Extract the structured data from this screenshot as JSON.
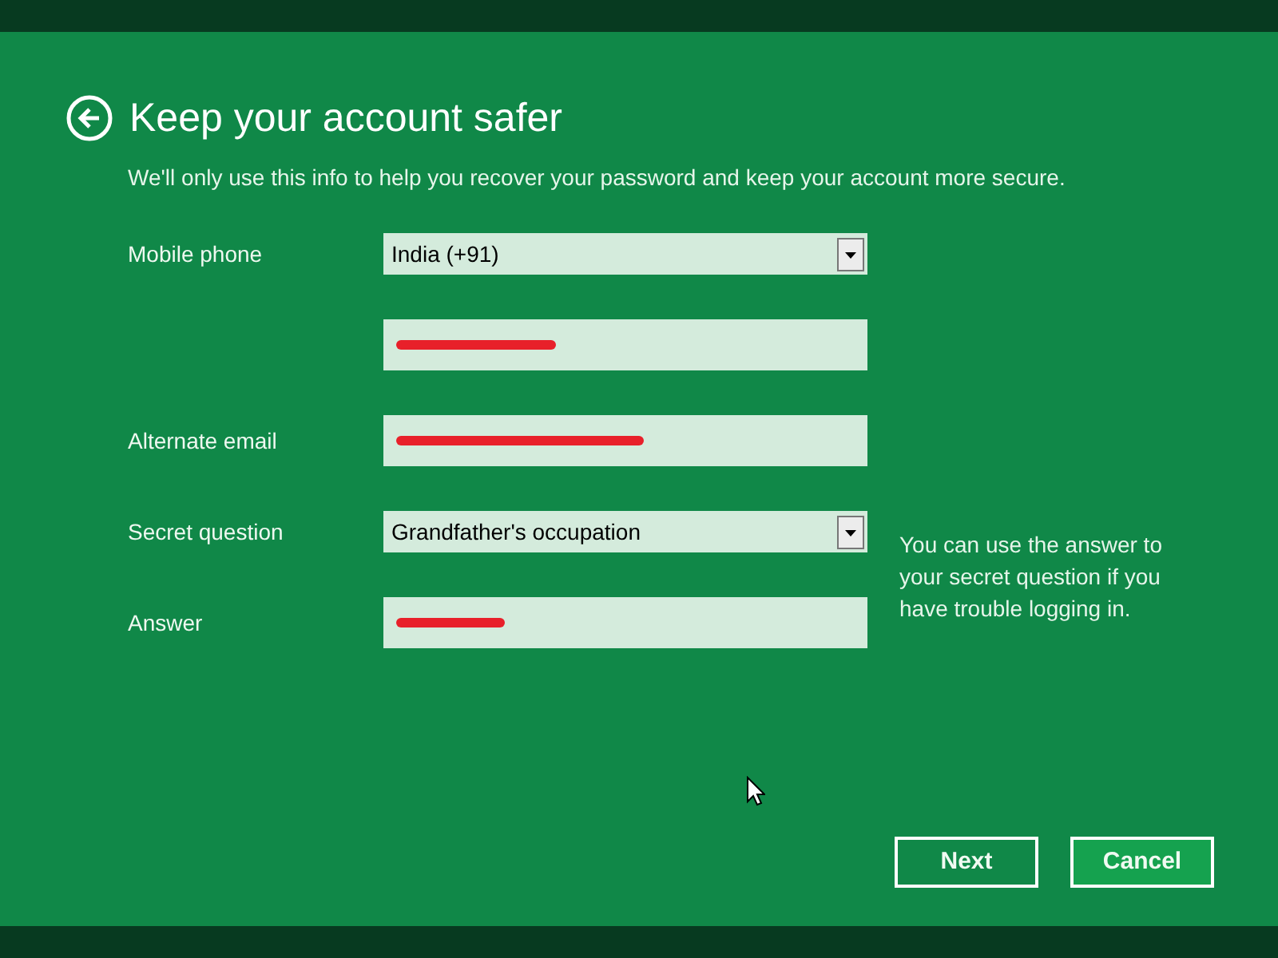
{
  "title": "Keep your account safer",
  "subtitle": "We'll only use this info to help you recover your password and keep your account more secure.",
  "fields": [
    {
      "label": "Mobile phone",
      "kind": "dropdown",
      "value": "India (+91)"
    },
    {
      "kind": "text",
      "redacted": true
    },
    {
      "label": "Alternate email",
      "kind": "text",
      "redacted": true
    },
    {
      "label": "Secret question",
      "kind": "dropdown",
      "value": "Grandfather's occupation"
    },
    {
      "label": "Answer",
      "kind": "text",
      "redacted": true
    }
  ],
  "help_text": "You can use the answer to your secret question if you have trouble logging in.",
  "buttons": [
    {
      "label": "Next",
      "highlighted": false
    },
    {
      "label": "Cancel",
      "highlighted": true
    }
  ]
}
